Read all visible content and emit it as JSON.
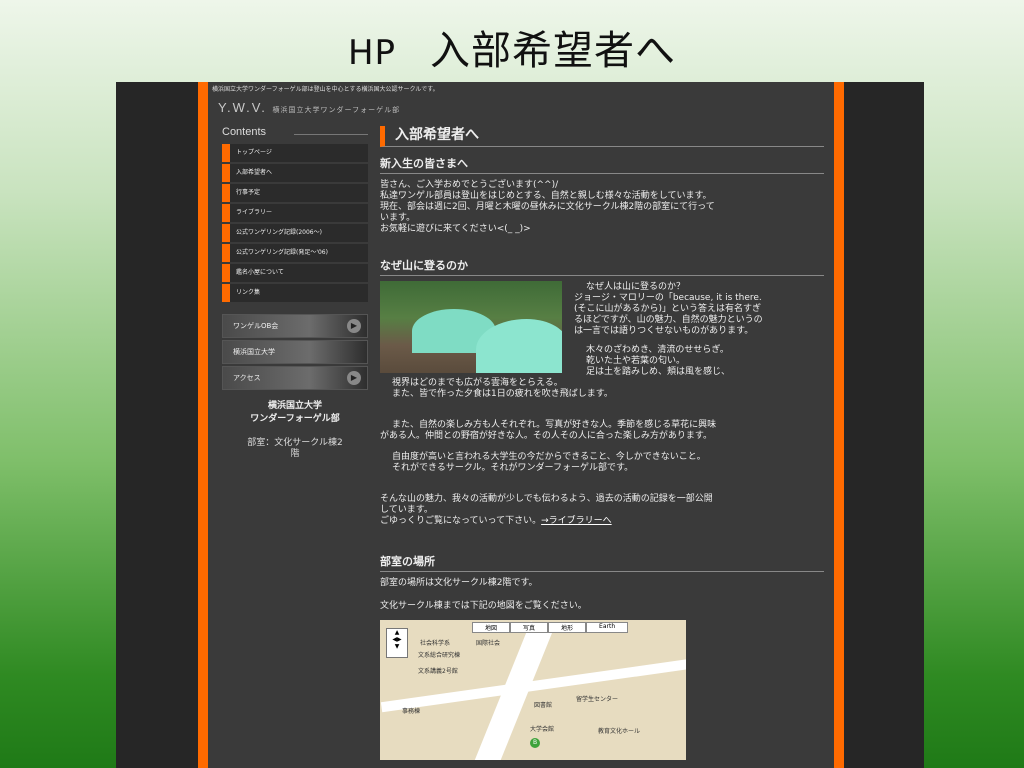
{
  "slide": {
    "title_prefix": "HP",
    "title": "入部希望者へ"
  },
  "site": {
    "top_text": "横浜国立大学ワンダーフォーゲル部は登山を中心とする横浜国大公認サークルです。",
    "logo": "Y.W.V.",
    "logo_sub": "横浜国立大学ワンダーフォーゲル部"
  },
  "sidebar": {
    "contents_heading": "Contents",
    "nav": [
      "トップページ",
      "入部希望者へ",
      "行事予定",
      "ライブラリー",
      "公式ワンゲリング記録(2006〜)",
      "公式ワンゲリング記録(発足〜'06)",
      "鑑名小屋について",
      "リンク集"
    ],
    "banners": [
      "ワンゲルOB会",
      "横浜国立大学",
      "アクセス"
    ],
    "club_name_1": "横浜国立大学",
    "club_name_2": "ワンダーフォーゲル部",
    "club_room_1": "部室：文化サークル棟2",
    "club_room_2": "階"
  },
  "main": {
    "heading": "入部希望者へ",
    "welcome_title": "新入生の皆さまへ",
    "welcome_lines": [
      "皆さん、ご入学おめでとうございます(^^)/",
      "私達ワンゲル部員は登山をはじめとする、自然と親しむ様々な活動をしています。",
      "現在、部会は週に2回、月曜と木曜の昼休みに文化サークル棟2階の部室にて行って",
      "います。",
      "お気軽に遊びに来てください<(_ _)>"
    ],
    "why_title": "なぜ山に登るのか",
    "why_lines": [
      "なぜ人は山に登るのか？",
      "ジョージ・マロリーの「because, it is there.",
      "(そこに山があるから)」という答えは有名すぎ",
      "るほどですが、山の魅力、自然の魅力というの",
      "は一言では語りつくせないものがあります。"
    ],
    "nature_lines": [
      "木々のざわめき、清流のせせらぎ。",
      "乾いた土や若葉の匂い。",
      "足は土を踏みしめ、頬は風を感じ、"
    ],
    "view_lines": [
      "視界はどのまでも広がる雲海をとらえる。",
      "また、皆で作った夕食は1日の疲れを吹き飛ばします。"
    ],
    "fun_lines": [
      "また、自然の楽しみ方も人それぞれ。写真が好きな人。季節を感じる草花に興味",
      "がある人。仲間との野宿が好きな人。その人その人に合った楽しみ方があります。"
    ],
    "freedom_lines": [
      "自由度が高いと言われる大学生の今だからできること、今しかできないこと。",
      "それができるサークル。それがワンダーフォーゲル部です。"
    ],
    "closing_lines": [
      "そんな山の魅力、我々の活動が少しでも伝わるよう、過去の活動の記録を一部公開",
      "しています。"
    ],
    "closing_last": "ごゆっくりご覧になっていって下さい。",
    "library_link": "→ライブラリーへ",
    "room_title": "部室の場所",
    "room_line1": "部室の場所は文化サークル棟2階です。",
    "room_line2": "文化サークル棟までは下記の地図をご覧ください。",
    "map_tabs": [
      "地図",
      "写真",
      "地形",
      "Earth"
    ],
    "map_labels": [
      "社会科学系",
      "国際社会",
      "文系総合研究棟",
      "文系講義2号館",
      "事務棟",
      "図書館",
      "留学生センター",
      "大学会館",
      "教育文化ホール"
    ],
    "map_marker": "B"
  }
}
